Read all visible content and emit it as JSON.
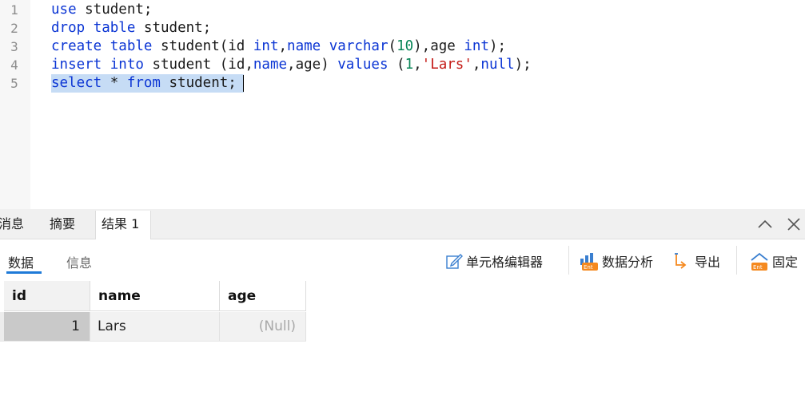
{
  "editor": {
    "line_numbers": [
      "1",
      "2",
      "3",
      "4",
      "5"
    ],
    "lines": [
      [
        {
          "t": "use",
          "c": "kw"
        },
        {
          "t": " student;",
          "c": ""
        }
      ],
      [
        {
          "t": "drop",
          "c": "kw"
        },
        {
          "t": " ",
          "c": ""
        },
        {
          "t": "table",
          "c": "kw"
        },
        {
          "t": " student;",
          "c": ""
        }
      ],
      [
        {
          "t": "create",
          "c": "kw"
        },
        {
          "t": " ",
          "c": ""
        },
        {
          "t": "table",
          "c": "kw"
        },
        {
          "t": " student(id ",
          "c": ""
        },
        {
          "t": "int",
          "c": "kw"
        },
        {
          "t": ",",
          "c": ""
        },
        {
          "t": "name",
          "c": "kw"
        },
        {
          "t": " ",
          "c": ""
        },
        {
          "t": "varchar",
          "c": "kw"
        },
        {
          "t": "(",
          "c": ""
        },
        {
          "t": "10",
          "c": "num"
        },
        {
          "t": "),age ",
          "c": ""
        },
        {
          "t": "int",
          "c": "kw"
        },
        {
          "t": ");",
          "c": ""
        }
      ],
      [
        {
          "t": "insert",
          "c": "kw"
        },
        {
          "t": " ",
          "c": ""
        },
        {
          "t": "into",
          "c": "kw"
        },
        {
          "t": " student (id,",
          "c": ""
        },
        {
          "t": "name",
          "c": "kw"
        },
        {
          "t": ",age) ",
          "c": ""
        },
        {
          "t": "values",
          "c": "kw"
        },
        {
          "t": " (",
          "c": ""
        },
        {
          "t": "1",
          "c": "num"
        },
        {
          "t": ",",
          "c": ""
        },
        {
          "t": "'Lars'",
          "c": "str"
        },
        {
          "t": ",",
          "c": ""
        },
        {
          "t": "null",
          "c": "kw"
        },
        {
          "t": ");",
          "c": ""
        }
      ],
      [
        {
          "t": "select",
          "c": "kw"
        },
        {
          "t": " * ",
          "c": ""
        },
        {
          "t": "from",
          "c": "kw"
        },
        {
          "t": " student;",
          "c": ""
        }
      ]
    ]
  },
  "result_tabs": {
    "messages": "消息",
    "summary": "摘要",
    "result1": "结果 1"
  },
  "subtabs": {
    "data": "数据",
    "info": "信息"
  },
  "toolbar": {
    "cell_editor": "单元格编辑器",
    "data_analysis": "数据分析",
    "export": "导出",
    "pin": "固定"
  },
  "grid": {
    "columns": [
      "id",
      "name",
      "age"
    ],
    "rows": [
      [
        "1",
        "Lars",
        "(Null)"
      ]
    ]
  },
  "colors": {
    "keyword": "#0b35d4",
    "number": "#098658",
    "string": "#c41a16",
    "selection": "#c6dcf5",
    "accent": "#1e7ad8",
    "icon_orange": "#f5891f"
  }
}
